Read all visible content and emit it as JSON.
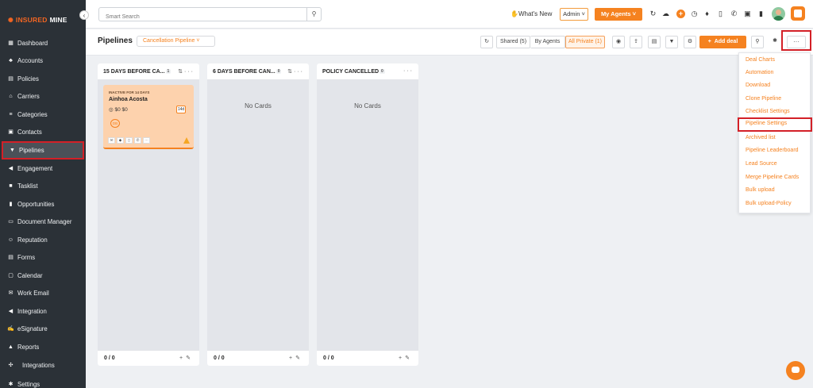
{
  "brand": {
    "logo_prefix": "INSURED",
    "logo_suffix": "MINE"
  },
  "sidebar": {
    "items": [
      {
        "label": "Dashboard",
        "icon": "dashboard-icon"
      },
      {
        "label": "Accounts",
        "icon": "accounts-icon"
      },
      {
        "label": "Policies",
        "icon": "policies-icon"
      },
      {
        "label": "Carriers",
        "icon": "carriers-icon"
      },
      {
        "label": "Categories",
        "icon": "categories-icon"
      },
      {
        "label": "Contacts",
        "icon": "contacts-icon"
      },
      {
        "label": "Pipelines",
        "icon": "filter-icon",
        "active": true
      },
      {
        "label": "Engagement",
        "icon": "megaphone-icon"
      },
      {
        "label": "Tasklist",
        "icon": "tasklist-icon"
      },
      {
        "label": "Opportunities",
        "icon": "bar-chart-icon"
      },
      {
        "label": "Document Manager",
        "icon": "folder-icon"
      },
      {
        "label": "Reputation",
        "icon": "reputation-icon"
      },
      {
        "label": "Forms",
        "icon": "forms-icon"
      },
      {
        "label": "Calendar",
        "icon": "calendar-icon"
      },
      {
        "label": "Work Email",
        "icon": "mail-icon"
      },
      {
        "label": "Integration",
        "icon": "megaphone-icon"
      },
      {
        "label": "eSignature",
        "icon": "signature-icon"
      },
      {
        "label": "Reports",
        "icon": "reports-icon"
      },
      {
        "label": "Integrations",
        "icon": "integrations-icon"
      },
      {
        "label": "Settings",
        "icon": "gear-icon"
      }
    ]
  },
  "topbar": {
    "search_placeholder": "Smart Search",
    "whats_new": "What's New",
    "admin": "Admin",
    "my_agents": "My Agents"
  },
  "header": {
    "title": "Pipelines",
    "pipeline_select": "Cancellation Pipeline",
    "shared": "Shared (5)",
    "by_agents": "By Agents",
    "all_private": "All Private (1)",
    "add_deal": "Add deal",
    "more": "···"
  },
  "columns": [
    {
      "title": "15 DAYS BEFORE CA...",
      "badge": "1",
      "count": "0 / 0"
    },
    {
      "title": "6 DAYS BEFORE CAN...",
      "badge": "0",
      "count": "0 / 0",
      "empty": "No Cards"
    },
    {
      "title": "POLICY CANCELLED",
      "badge": "0",
      "count": "0 / 0",
      "empty": "No Cards"
    }
  ],
  "card": {
    "tag": "INACTIVE FOR 14 DAYS",
    "name": "Ainhoa Acosta",
    "amounts": "$0  $0",
    "days": "14d",
    "initials": "DB"
  },
  "menu": {
    "items": [
      "Deal Charts",
      "Automation",
      "Download",
      "Clone Pipeline",
      "Checklist Settings",
      "Pipeline Settings",
      "Archived list",
      "Pipeline Leaderboard",
      "Lead Source",
      "Merge Pipeline Cards",
      "Bulk upload",
      "Bulk upload-Policy"
    ],
    "highlighted": "Pipeline Settings"
  },
  "colors": {
    "accent": "#f58220",
    "sidebar_bg": "#2b3137",
    "highlight": "#d32027"
  }
}
